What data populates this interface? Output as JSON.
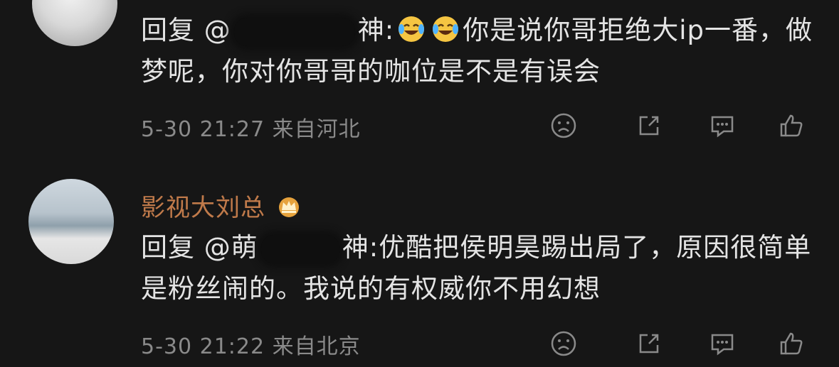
{
  "comments": [
    {
      "reply_prefix": "回复",
      "mention_prefix": "@",
      "mention_suffix": "神",
      "text": "你是说你哥拒绝大ip一番，做梦呢，你对你哥哥的咖位是不是有误会",
      "emoji": [
        "grinning-squinting-face-with-tears",
        "grinning-squinting-face-with-tears"
      ],
      "date": "5-30 21:27",
      "location": "来自河北"
    },
    {
      "username": "影视大刘总",
      "badge": "crown-icon",
      "reply_prefix": "回复",
      "mention_prefix": "@",
      "mention_visible": "萌",
      "mention_suffix": "神",
      "text": "优酷把侯明昊踢出局了，原因很简单是粉丝闹的。我说的有权威你不用幻想",
      "date": "5-30 21:22",
      "location": "来自北京"
    }
  ],
  "colors": {
    "background": "#161616",
    "username": "#c07a4a",
    "meta": "#8a8a8a",
    "text": "#e4e4e4"
  }
}
